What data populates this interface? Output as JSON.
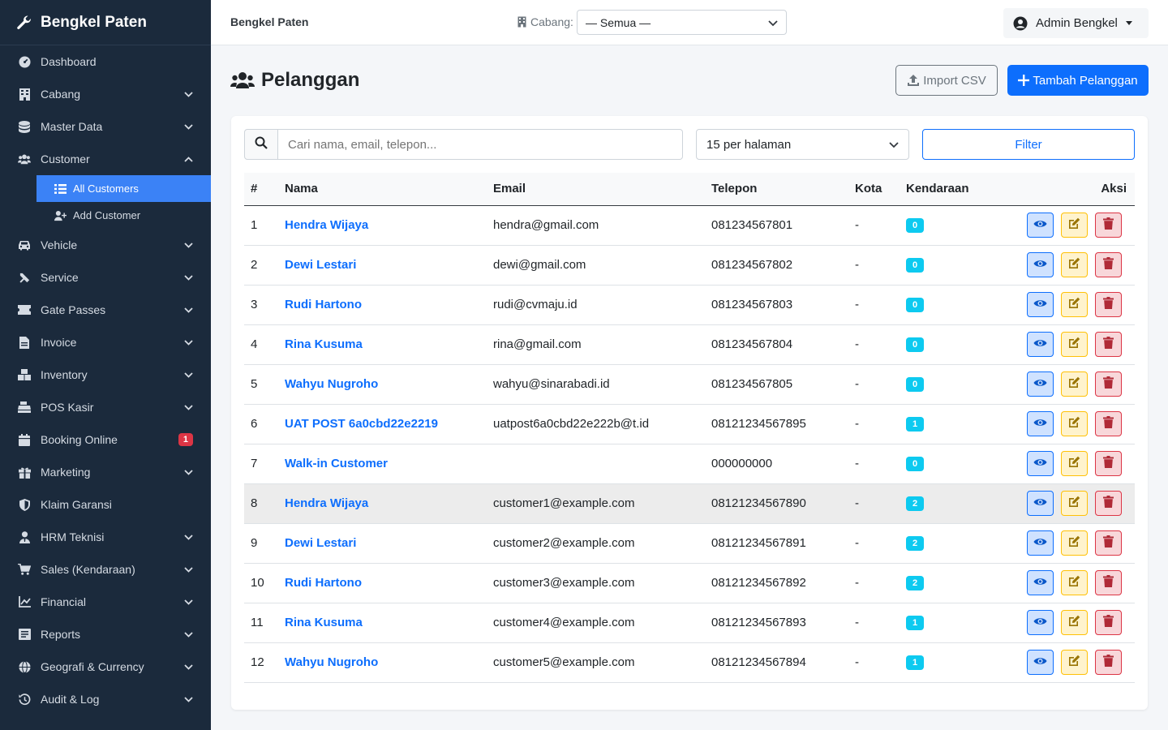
{
  "brand": {
    "name": "Bengkel Paten"
  },
  "sidebar": {
    "items": [
      {
        "label": "Dashboard",
        "icon": "gauge-icon",
        "chevron": false
      },
      {
        "label": "Cabang",
        "icon": "building-icon",
        "chevron": true
      },
      {
        "label": "Master Data",
        "icon": "database-icon",
        "chevron": true
      },
      {
        "label": "Customer",
        "icon": "users-icon",
        "chevron": true,
        "expanded": true
      },
      {
        "label": "Vehicle",
        "icon": "car-icon",
        "chevron": true
      },
      {
        "label": "Service",
        "icon": "tools-icon",
        "chevron": true
      },
      {
        "label": "Gate Passes",
        "icon": "ticket-icon",
        "chevron": true
      },
      {
        "label": "Invoice",
        "icon": "file-invoice-icon",
        "chevron": true
      },
      {
        "label": "Inventory",
        "icon": "boxes-icon",
        "chevron": true
      },
      {
        "label": "POS Kasir",
        "icon": "cash-register-icon",
        "chevron": true
      },
      {
        "label": "Booking Online",
        "icon": "calendar-icon",
        "chevron": false,
        "badge": "1"
      },
      {
        "label": "Marketing",
        "icon": "gift-icon",
        "chevron": true
      },
      {
        "label": "Klaim Garansi",
        "icon": "shield-icon",
        "chevron": false
      },
      {
        "label": "HRM Teknisi",
        "icon": "user-tie-icon",
        "chevron": true
      },
      {
        "label": "Sales (Kendaraan)",
        "icon": "cart-icon",
        "chevron": true
      },
      {
        "label": "Financial",
        "icon": "chart-line-icon",
        "chevron": true
      },
      {
        "label": "Reports",
        "icon": "report-icon",
        "chevron": true
      },
      {
        "label": "Geografi & Currency",
        "icon": "globe-icon",
        "chevron": true
      },
      {
        "label": "Audit & Log",
        "icon": "history-icon",
        "chevron": true
      }
    ],
    "customer_sub": [
      {
        "label": "All Customers",
        "icon": "list-icon",
        "active": true
      },
      {
        "label": "Add Customer",
        "icon": "user-plus-icon",
        "active": false
      }
    ]
  },
  "topbar": {
    "title": "Bengkel Paten",
    "branch_label": "Cabang:",
    "branch_value": "— Semua —",
    "user": "Admin Bengkel"
  },
  "page": {
    "title": "Pelanggan",
    "import_label": "Import CSV",
    "add_label": "Tambah Pelanggan"
  },
  "filters": {
    "search_placeholder": "Cari nama, email, telepon...",
    "per_page": "15 per halaman",
    "filter_label": "Filter"
  },
  "table": {
    "headers": {
      "no": "#",
      "name": "Nama",
      "email": "Email",
      "phone": "Telepon",
      "city": "Kota",
      "vehicles": "Kendaraan",
      "actions": "Aksi"
    },
    "rows": [
      {
        "no": "1",
        "name": "Hendra Wijaya",
        "email": "hendra@gmail.com",
        "phone": "081234567801",
        "city": "-",
        "vehicles": "0"
      },
      {
        "no": "2",
        "name": "Dewi Lestari",
        "email": "dewi@gmail.com",
        "phone": "081234567802",
        "city": "-",
        "vehicles": "0"
      },
      {
        "no": "3",
        "name": "Rudi Hartono",
        "email": "rudi@cvmaju.id",
        "phone": "081234567803",
        "city": "-",
        "vehicles": "0"
      },
      {
        "no": "4",
        "name": "Rina Kusuma",
        "email": "rina@gmail.com",
        "phone": "081234567804",
        "city": "-",
        "vehicles": "0"
      },
      {
        "no": "5",
        "name": "Wahyu Nugroho",
        "email": "wahyu@sinarabadi.id",
        "phone": "081234567805",
        "city": "-",
        "vehicles": "0"
      },
      {
        "no": "6",
        "name": "UAT POST 6a0cbd22e2219",
        "email": "uatpost6a0cbd22e222b@t.id",
        "phone": "08121234567895",
        "city": "-",
        "vehicles": "1"
      },
      {
        "no": "7",
        "name": "Walk-in Customer",
        "email": "",
        "phone": "000000000",
        "city": "-",
        "vehicles": "0"
      },
      {
        "no": "8",
        "name": "Hendra Wijaya",
        "email": "customer1@example.com",
        "phone": "08121234567890",
        "city": "-",
        "vehicles": "2",
        "highlight": true
      },
      {
        "no": "9",
        "name": "Dewi Lestari",
        "email": "customer2@example.com",
        "phone": "08121234567891",
        "city": "-",
        "vehicles": "2"
      },
      {
        "no": "10",
        "name": "Rudi Hartono",
        "email": "customer3@example.com",
        "phone": "08121234567892",
        "city": "-",
        "vehicles": "2"
      },
      {
        "no": "11",
        "name": "Rina Kusuma",
        "email": "customer4@example.com",
        "phone": "08121234567893",
        "city": "-",
        "vehicles": "1"
      },
      {
        "no": "12",
        "name": "Wahyu Nugroho",
        "email": "customer5@example.com",
        "phone": "08121234567894",
        "city": "-",
        "vehicles": "1"
      }
    ]
  },
  "colors": {
    "sidebar_bg": "#1b2a3c",
    "primary": "#0d6efd",
    "info": "#0dcaf0",
    "warning": "#ffc107",
    "danger": "#dc3545"
  }
}
